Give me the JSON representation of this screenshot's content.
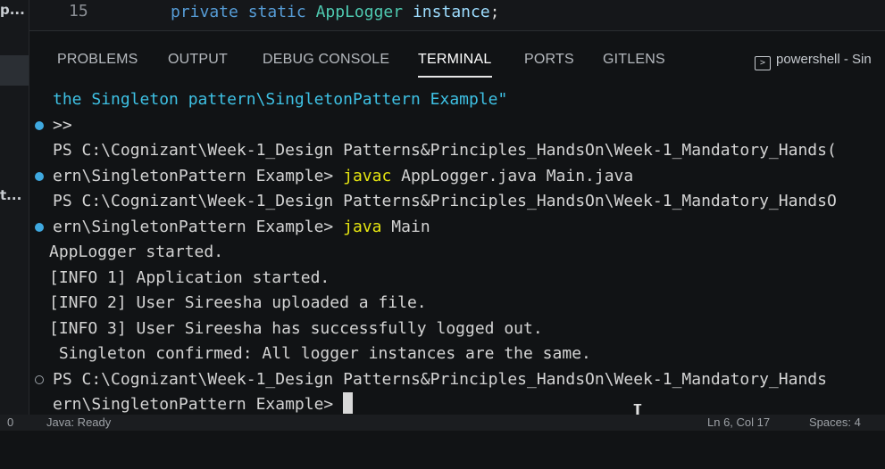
{
  "left_fragments": [
    "p...",
    "t..."
  ],
  "editor": {
    "line_number": "15",
    "tokens": {
      "kw1": "private",
      "kw2": "static",
      "type": "AppLogger",
      "var": "instance",
      "semi": ";"
    }
  },
  "panel_tabs": [
    {
      "label": "PROBLEMS"
    },
    {
      "label": "OUTPUT"
    },
    {
      "label": "DEBUG CONSOLE"
    },
    {
      "label": "TERMINAL",
      "active": true
    },
    {
      "label": "PORTS"
    },
    {
      "label": "GITLENS"
    }
  ],
  "shell_label": "powershell - Sin",
  "terminal": {
    "line1": "the Singleton pattern\\SingletonPattern Example\"",
    "line2": ">>",
    "ps1": "PS C:\\Cognizant\\Week-1_Design Patterns&Principles_HandsOn\\Week-1_Mandatory_Hands(",
    "cmd1_prefix": "ern\\SingletonPattern Example> ",
    "cmd1_keyword": "javac",
    "cmd1_args": " AppLogger.java Main.java",
    "ps2": "PS C:\\Cognizant\\Week-1_Design Patterns&Principles_HandsOn\\Week-1_Mandatory_HandsO",
    "cmd2_prefix": "ern\\SingletonPattern Example> ",
    "cmd2_keyword": "java",
    "cmd2_args": " Main",
    "out1": "AppLogger started.",
    "out2": "[INFO 1] Application started.",
    "out3": "[INFO 2] User Sireesha uploaded a file.",
    "out4": "[INFO 3] User Sireesha has successfully logged out.",
    "out5": " Singleton confirmed: All logger instances are the same.",
    "ps3": "PS C:\\Cognizant\\Week-1_Design Patterns&Principles_HandsOn\\Week-1_Mandatory_Hands",
    "prompt": "ern\\SingletonPattern Example> "
  },
  "status_bar": {
    "left": "0",
    "language": "Java: Ready",
    "position": "Ln 6, Col 17",
    "spaces": "Spaces: 4"
  },
  "colors": {
    "background": "#111315",
    "accent_blue": "#3fa9e0",
    "path_cyan": "#3ec1e4",
    "command_yellow": "#e5e510"
  }
}
